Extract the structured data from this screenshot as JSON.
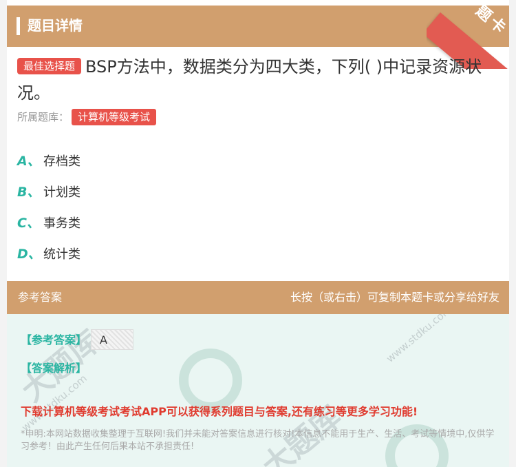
{
  "header": {
    "title": "题目详情",
    "corner_label": "题卡"
  },
  "question": {
    "badge": "最佳选择题",
    "text": "BSP方法中，数据类分为四大类，下列( )中记录资源状况。",
    "source_label": "所属题库：",
    "source_tag": "计算机等级考试"
  },
  "options": [
    {
      "letter": "A、",
      "text": "存档类"
    },
    {
      "letter": "B、",
      "text": "计划类"
    },
    {
      "letter": "C、",
      "text": "事务类"
    },
    {
      "letter": "D、",
      "text": "统计类"
    }
  ],
  "answer": {
    "head_left": "参考答案",
    "head_right": "长按（或右击）可复制本题卡或分享给好友",
    "ref_label": "【参考答案】",
    "ref_value": "A",
    "exp_label": "【答案解析】",
    "promo": "下载计算机等级考试考试APP可以获得系列题目与答案,还有练习等更多学习功能!",
    "disclaimer": "*申明:本网站数据收集整理于互联网!我们并未能对答案信息进行核对!本信息不能用于生产、生活、考试等情境中,仅供学习参考！由此产生任何后果本站不承担责任!"
  },
  "watermark": {
    "brand": "大题库",
    "site": "www.stdku.com"
  },
  "colors": {
    "header": "#d19f6e",
    "accent_red": "#e8524a",
    "teal": "#2ab5a2",
    "answer_bg": "#eaf6f3"
  }
}
